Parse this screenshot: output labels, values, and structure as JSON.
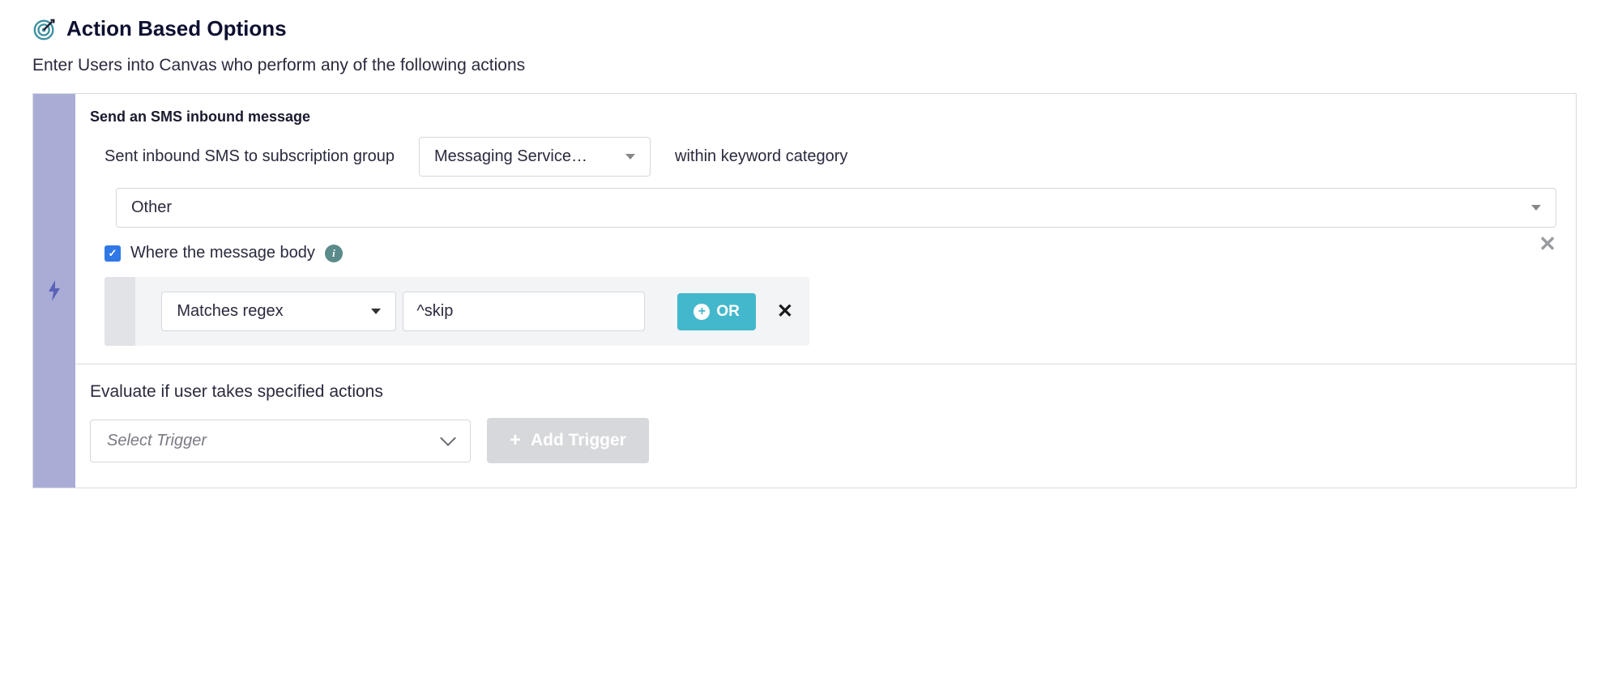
{
  "header": {
    "title": "Action Based Options",
    "subtitle": "Enter Users into Canvas who perform any of the following actions"
  },
  "trigger": {
    "title": "Send an SMS inbound message",
    "label_sent": "Sent inbound SMS to subscription group",
    "subscription_select": "Messaging Service…",
    "label_within": "within keyword category",
    "keyword_select": "Other",
    "checkbox_label": "Where the message body",
    "filter": {
      "operator": "Matches regex",
      "value": "^skip",
      "or_label": "OR"
    }
  },
  "evaluate": {
    "label": "Evaluate if user takes specified actions",
    "select_placeholder": "Select Trigger",
    "add_button": "Add Trigger"
  }
}
